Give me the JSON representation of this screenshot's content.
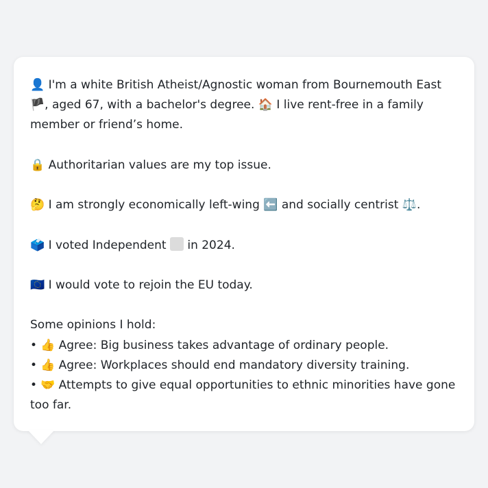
{
  "profile": {
    "identity": {
      "icon": "👤",
      "text_before_flag": "I'm a white British Atheist/Agnostic woman from Bournemouth East",
      "flag": "🏴",
      "text_after_flag": ", aged 67, with a bachelor's degree.",
      "home_icon": "🏠",
      "home_text": "I live rent-free in a family member or friend’s home."
    },
    "top_issue": {
      "icon": "🔒",
      "text": "Authoritarian values are my top issue."
    },
    "ideology": {
      "icon": "🤔",
      "text_before": "I am strongly economically left-wing",
      "left_icon": "⬅️",
      "text_middle": "and socially centrist",
      "scales_icon": "⚖️",
      "text_after": "."
    },
    "vote": {
      "icon": "🗳️",
      "text_before": "I voted Independent",
      "text_after": "in 2024."
    },
    "eu": {
      "icon": "🇪🇺",
      "text": "I would vote to rejoin the EU today."
    },
    "opinions": {
      "heading": "Some opinions I hold:",
      "bullet": "•",
      "items": [
        {
          "icon": "👍",
          "text": "Agree: Big business takes advantage of ordinary people."
        },
        {
          "icon": "👍",
          "text": "Agree: Workplaces should end mandatory diversity training."
        },
        {
          "icon": "🤝",
          "text": "Attempts to give equal opportunities to ethnic minorities have gone too far."
        }
      ]
    }
  },
  "colors": {
    "background": "#f2f3f5",
    "bubble": "#ffffff",
    "text": "#1f2328",
    "independent_swatch": "#dcdcdc"
  }
}
